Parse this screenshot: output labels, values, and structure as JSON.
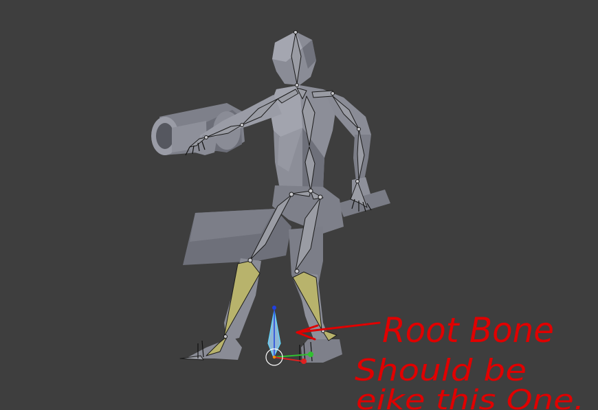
{
  "viewport": {
    "background": "#3e3e3e"
  },
  "colors": {
    "mesh_fill": "#8a8c96",
    "mesh_dark": "#5c5e68",
    "mesh_light": "#a6a8b2",
    "bone_fill": "#9a9ca4",
    "bone_edge": "#1a1a1a",
    "selected_bone_fill": "#b8b36c",
    "root_bone_fill": "#8fb6d4",
    "root_bone_outline": "#5fd8ff",
    "annotation_red": "#e00000",
    "gizmo_x": "#e02020",
    "gizmo_y": "#30c030",
    "gizmo_z": "#2040e0"
  },
  "annotation": {
    "line1": "Root Bone",
    "line2": "Should be",
    "line3": "eike this One."
  },
  "icons": [
    "3d-cursor-icon",
    "transform-gizmo-icon"
  ]
}
